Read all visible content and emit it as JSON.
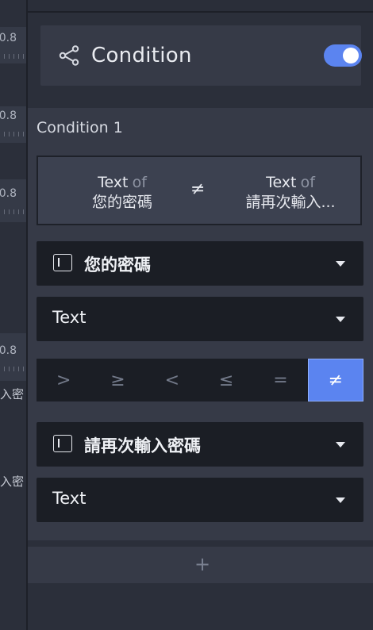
{
  "canvas": {
    "values": [
      "0.8",
      "0.8",
      "0.8",
      "0.8"
    ],
    "cjk_fragments": [
      "入密",
      "入密"
    ]
  },
  "header": {
    "icon": "share-nodes-icon",
    "title": "Condition",
    "toggle_on": true
  },
  "condition": {
    "label": "Condition 1",
    "summary": {
      "left_type": "Text",
      "left_of": "of",
      "left_field": "您的密碼",
      "operator": "≠",
      "right_type": "Text",
      "right_of": "of",
      "right_field": "請再次輸入..."
    },
    "left_field_select": "您的密碼",
    "left_type_select": "Text",
    "operators": [
      ">",
      "≥",
      "<",
      "≤",
      "=",
      "≠"
    ],
    "active_operator": "≠",
    "right_field_select": "請再次輸入密碼",
    "right_type_select": "Text"
  },
  "add": {
    "label": "+"
  },
  "colors": {
    "accent": "#5b84f0",
    "panel_bg": "#2b2f3a",
    "section_bg": "#363a47",
    "dropdown_bg": "#1b1e25"
  }
}
